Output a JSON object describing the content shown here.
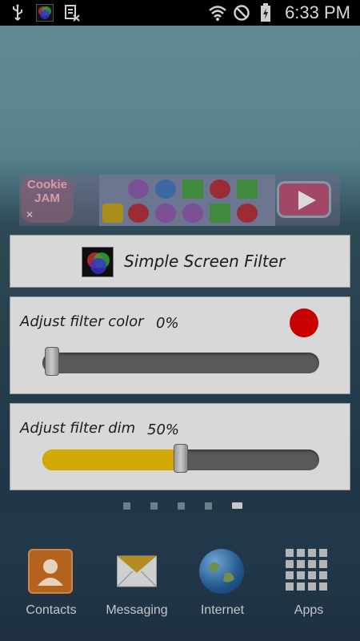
{
  "status_bar": {
    "time": "6:33 PM",
    "left_icons": [
      "usb-icon",
      "screen-filter-app-icon",
      "storage-icon"
    ],
    "right_icons": [
      "wifi-icon",
      "no-sim-icon",
      "battery-charging-icon"
    ]
  },
  "ad": {
    "logo_line1": "Cookie",
    "logo_line2": "JAM",
    "close_label": "✕"
  },
  "app_title": {
    "title": "Simple Screen Filter"
  },
  "filter_color": {
    "label": "Adjust filter color",
    "percent": "0%",
    "value_fraction": 0.0,
    "swatch_color": "#c90000"
  },
  "filter_dim": {
    "label": "Adjust filter dim",
    "percent": "50%",
    "value_fraction": 0.5,
    "fill_color": "#d2a900"
  },
  "page_indicator": {
    "count": 5,
    "active_index": 4
  },
  "dock": {
    "items": [
      {
        "label": "Contacts",
        "icon": "contacts-icon"
      },
      {
        "label": "Messaging",
        "icon": "messaging-icon"
      },
      {
        "label": "Internet",
        "icon": "internet-icon"
      },
      {
        "label": "Apps",
        "icon": "apps-grid-icon"
      }
    ]
  }
}
